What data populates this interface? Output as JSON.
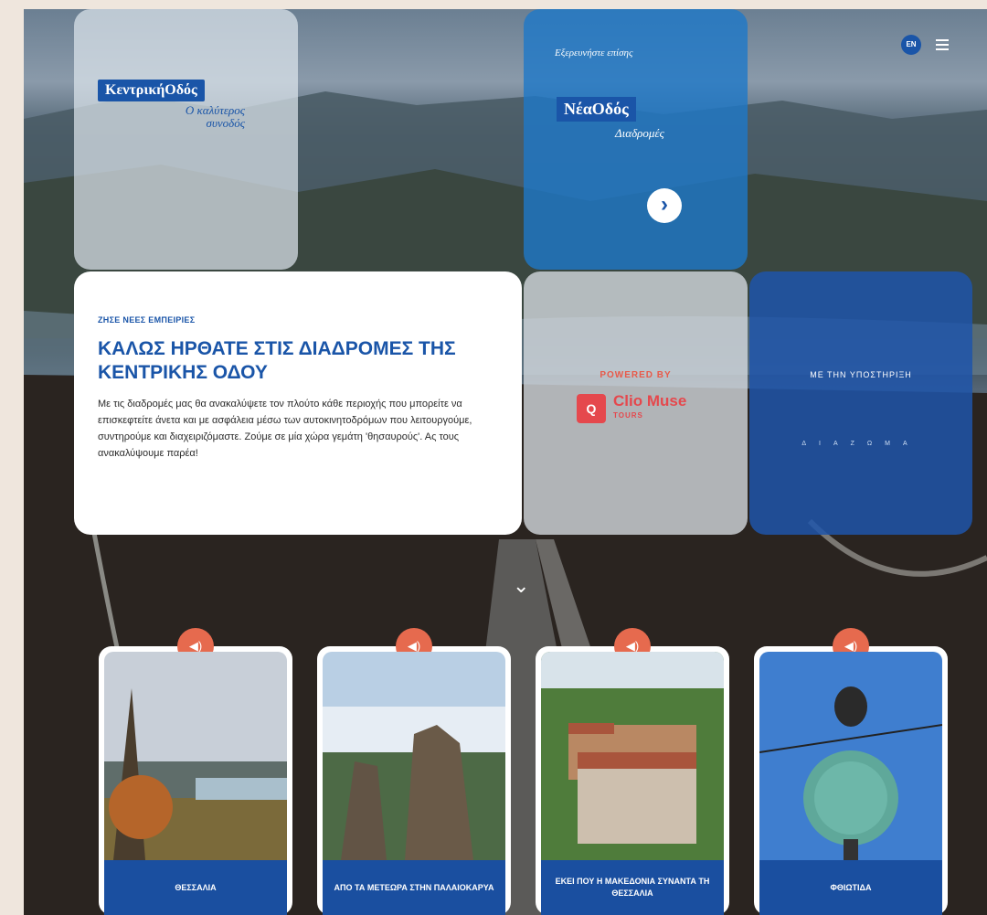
{
  "header": {
    "lang_label": "EN"
  },
  "logo": {
    "brand": "ΚεντρικήΟδός",
    "tagline": "Ο καλύτερος συνοδός"
  },
  "partner": {
    "intro": "Εξερευνήστε επίσης",
    "brand": "ΝέαΟδός",
    "sub": "Διαδρομές"
  },
  "welcome": {
    "eyebrow": "ΖΗΣΕ ΝΕΕΣ ΕΜΠΕΙΡΙΕΣ",
    "title": "ΚΑΛΩΣ ΗΡΘΑΤΕ ΣΤΙΣ ΔΙΑΔΡΟΜΕΣ ΤΗΣ ΚΕΝΤΡΙΚΗΣ ΟΔΟΥ",
    "body": "Με τις διαδρομές μας θα ανακαλύψετε τον πλούτο κάθε περιοχής που μπορείτε να επισκεφτείτε άνετα και με ασφάλεια μέσω των αυτοκινητοδρόμων που λειτουργούμε, συντηρούμε και διαχειριζόμαστε. Ζούμε σε μία χώρα γεμάτη 'θησαυρούς'. Ας τους ανακαλύψουμε παρέα!"
  },
  "powered": {
    "label": "POWERED BY",
    "brand": "Clio Muse",
    "brand_sub": "TOURS",
    "mark": "Q"
  },
  "support": {
    "label": "ΜΕ ΤΗΝ ΥΠΟΣΤΗΡΙΞΗ",
    "logo_text": "ΔΙΑΖΩΜΑ"
  },
  "cards": [
    {
      "title": "ΘΕΣΣΑΛΙΑ"
    },
    {
      "title": "ΑΠΟ ΤΑ ΜΕΤΕΩΡΑ ΣΤΗΝ ΠΑΛΑΙΟΚΑΡΥΑ"
    },
    {
      "title": "ΕΚΕΙ ΠΟΥ Η ΜΑΚΕΔΟΝΙΑ ΣΥΝΑΝΤΑ ΤΗ ΘΕΣΣΑΛΙΑ"
    },
    {
      "title": "ΦΘΙΩΤΙΔΑ"
    }
  ],
  "icons": {
    "sound": "speaker-icon",
    "next": "chevron-right-icon",
    "scroll": "chevron-down-icon",
    "menu": "hamburger-icon"
  },
  "colors": {
    "brand_blue": "#1a55a8",
    "accent_orange": "#e66a4e",
    "clio_red": "#e5484d"
  }
}
